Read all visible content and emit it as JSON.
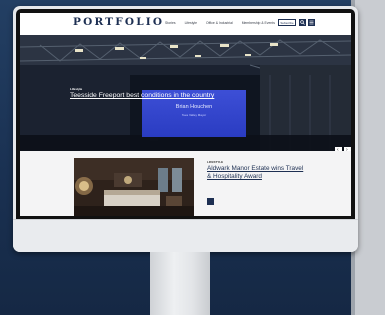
{
  "site": {
    "logo": "PORTFOLIO",
    "logo_sub": "",
    "nav": [
      "Stories",
      "Lifestyle",
      "Office & Industrial",
      "Membership & Events"
    ],
    "subscribe_label": "Subscribe"
  },
  "hero": {
    "tag": "Lifestyle",
    "title": "Teesside Freeport best conditions in the country",
    "excerpt": "",
    "stage_name": "Brian Houchen",
    "stage_role": "Tees Valley Mayor"
  },
  "feature": {
    "tag": "LIFESTYLE",
    "title": "Aldwark Manor Estate wins Travel & Hospitality Award",
    "excerpt": ""
  },
  "colors": {
    "brand_navy": "#1d2f52",
    "backdrop": "#1d3556",
    "stage_screen": "#3346cf"
  },
  "icons": {
    "search": "search-icon",
    "menu": "menu-icon",
    "prev": "chevron-left-icon",
    "next": "chevron-right-icon"
  }
}
